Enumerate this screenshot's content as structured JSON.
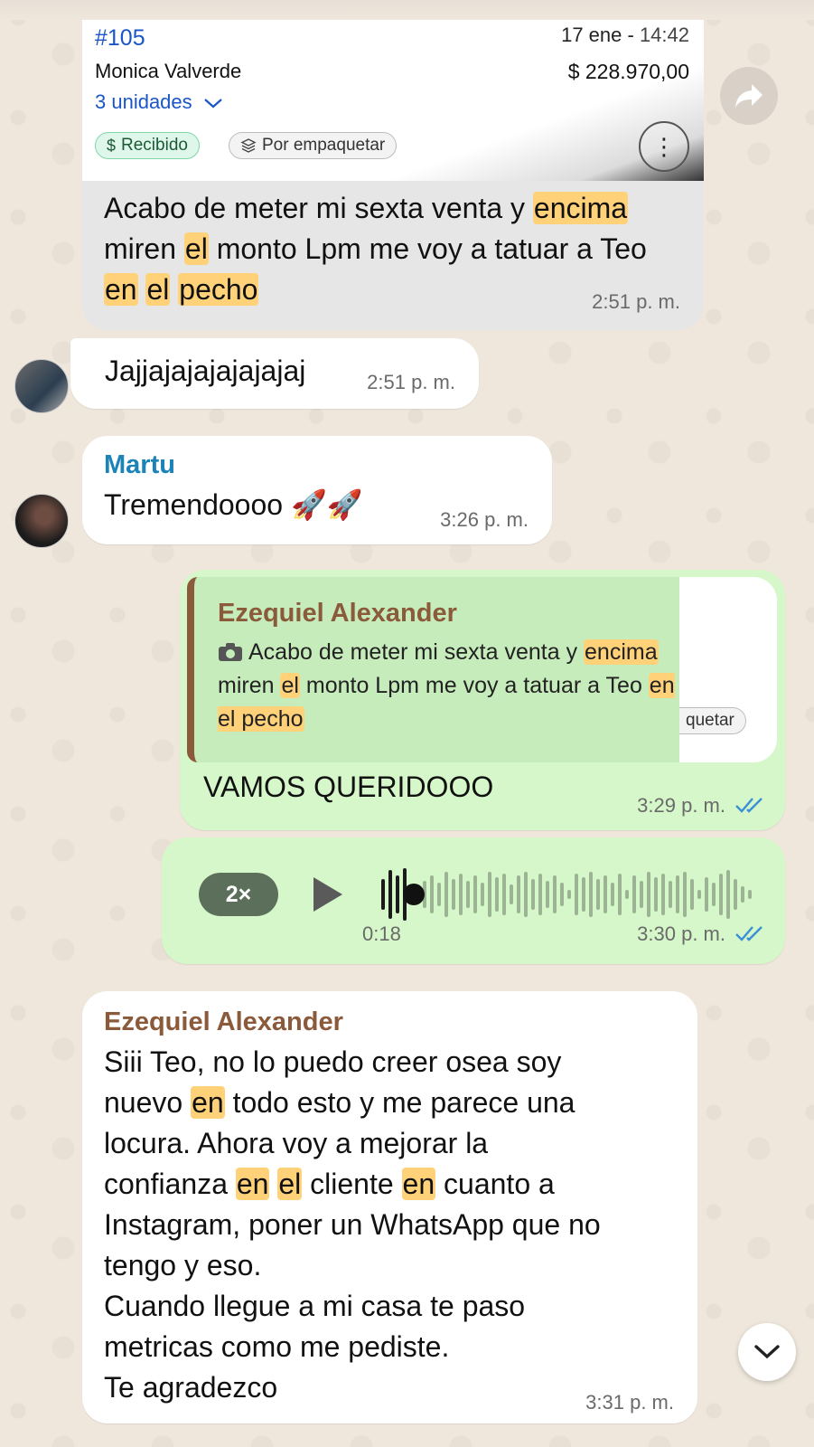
{
  "order_card": {
    "code": "#105",
    "date": "17 ene - ",
    "time": "14:42",
    "customer": "Monica Valverde",
    "amount": "$ 228.970,00",
    "units": "3 unidades",
    "status_received": "Recibido",
    "status_pack": "Por empaquetar",
    "status_pack_fragment": "quetar"
  },
  "messages": [
    {
      "id": "m1",
      "direction": "incoming",
      "parts": [
        "Acabo de meter mi sexta venta y ",
        "encima",
        " miren ",
        "el",
        " monto Lpm me voy a tatuar a Teo ",
        "en",
        " ",
        "el",
        " ",
        "pecho"
      ],
      "time": "2:51 p. m."
    },
    {
      "id": "m2",
      "direction": "incoming",
      "text": "Jajjajajajajajajaj",
      "time": "2:51 p. m."
    },
    {
      "id": "m3",
      "direction": "incoming",
      "sender": "Martu",
      "text": "Tremendoooo 🚀🚀",
      "time": "3:26 p. m."
    },
    {
      "id": "m4",
      "direction": "outgoing",
      "quote_sender": "Ezequiel Alexander",
      "quote_parts": [
        "Acabo de meter mi sexta venta y ",
        "encima",
        " miren ",
        "el",
        " monto Lpm me voy a tatuar a Teo ",
        "en el pecho"
      ],
      "text": "VAMOS QUERIDOOO",
      "time": "3:29 p. m."
    },
    {
      "id": "m5",
      "direction": "outgoing",
      "type": "audio",
      "speed": "2×",
      "duration": "0:18",
      "time": "3:30 p. m."
    },
    {
      "id": "m6",
      "direction": "incoming",
      "sender": "Ezequiel Alexander",
      "lines": [
        [
          "Siii Teo, no lo puedo creer osea soy"
        ],
        [
          "nuevo ",
          "en",
          " todo esto y me parece una"
        ],
        [
          "locura. Ahora voy a mejorar la"
        ],
        [
          "confianza ",
          "en",
          " ",
          "el",
          " cliente ",
          "en",
          " cuanto a"
        ],
        [
          "Instagram, poner un WhatsApp que no"
        ],
        [
          "tengo y eso."
        ],
        [
          "Cuando llegue a mi casa te paso"
        ],
        [
          "metricas como me pediste."
        ],
        [
          "Te agradezco"
        ]
      ],
      "time": "3:31 p. m."
    }
  ],
  "colors": {
    "incoming_bubble": "#ffffff",
    "outgoing_bubble": "#d6f7c9",
    "highlight": "#ffd27a",
    "sender_martu": "#1b83b8",
    "sender_ezequiel": "#8a5a3a",
    "read_ticks": "#3b8fd6"
  },
  "icons": [
    "forward-icon",
    "chevron-down-icon",
    "dollar-icon",
    "box-icon",
    "kebab-icon",
    "camera-icon",
    "play-icon",
    "double-check-icon",
    "scroll-down-icon"
  ]
}
